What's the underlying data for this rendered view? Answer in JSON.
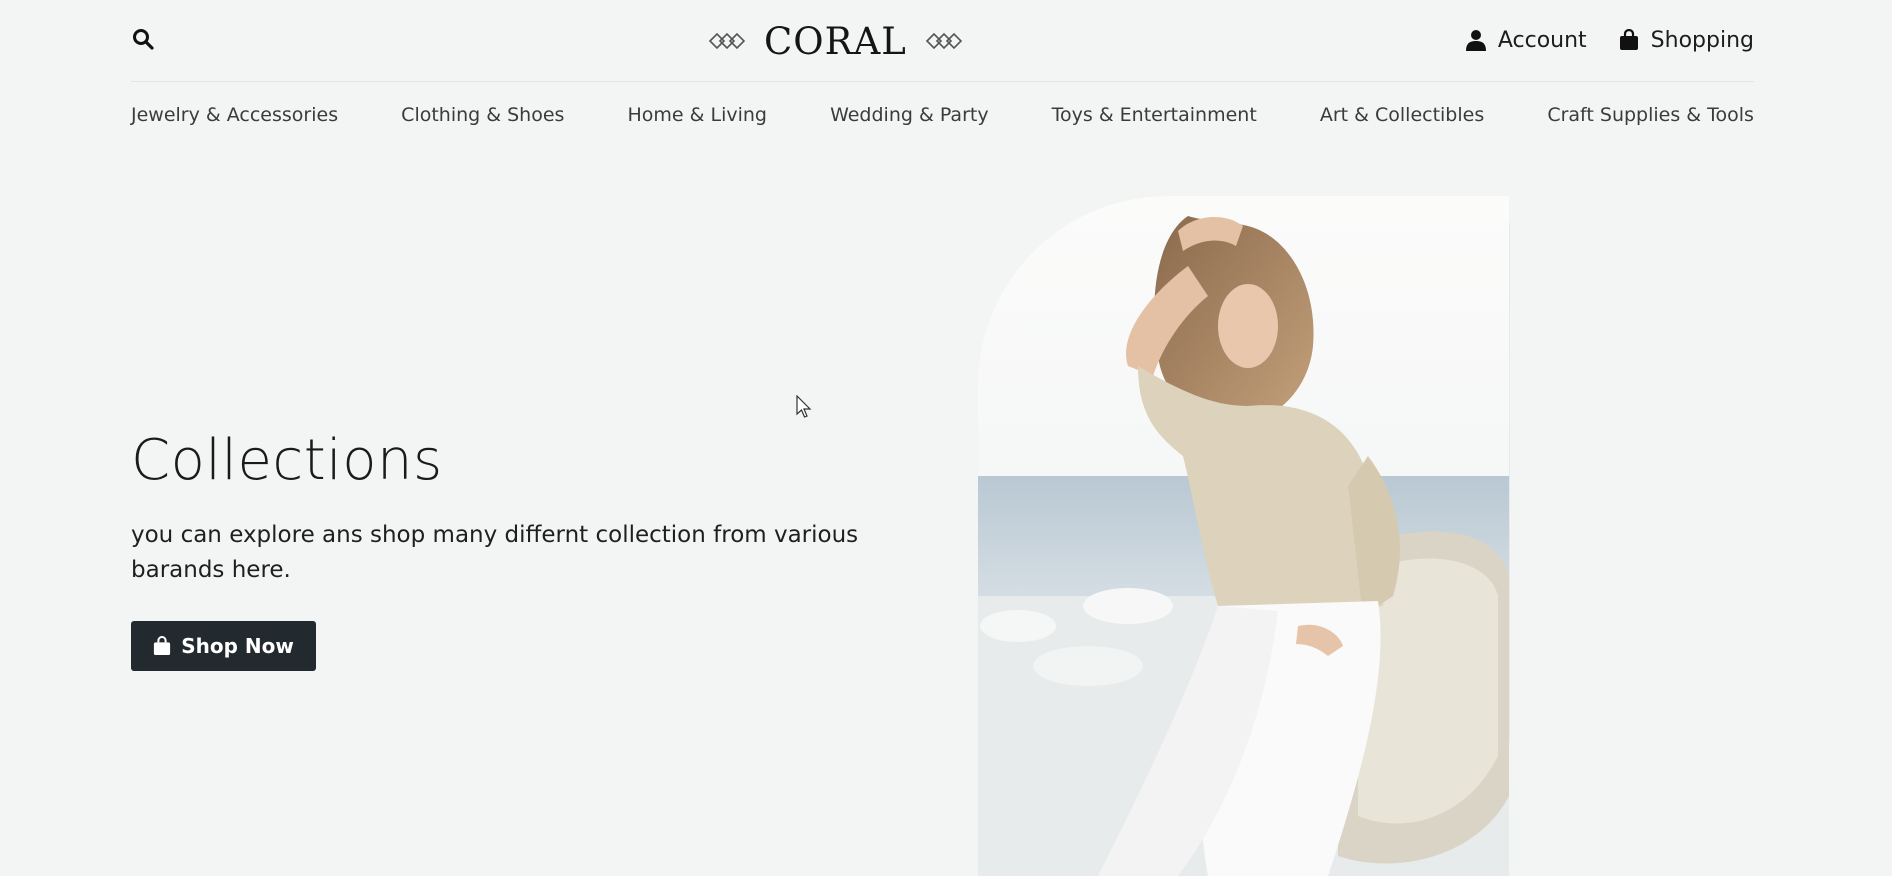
{
  "header": {
    "logo_text": "CORAL",
    "account_label": "Account",
    "shopping_label": "Shopping"
  },
  "nav": {
    "items": [
      {
        "label": "Jewelry & Accessories"
      },
      {
        "label": "Clothing & Shoes"
      },
      {
        "label": "Home & Living"
      },
      {
        "label": "Wedding & Party"
      },
      {
        "label": "Toys & Entertainment"
      },
      {
        "label": "Art & Collectibles"
      },
      {
        "label": "Craft Supplies & Tools"
      }
    ]
  },
  "hero": {
    "title": "Collections",
    "subtitle": "you can explore ans shop many differnt collection from various barands here.",
    "cta_label": "Shop Now"
  },
  "icons": {
    "search": "search-icon",
    "account": "user-icon",
    "shopping": "shopping-bag-icon",
    "cta": "shopping-bag-icon"
  },
  "colors": {
    "background": "#f3f4f4",
    "button": "#222a30",
    "text": "#1a1a1a"
  }
}
